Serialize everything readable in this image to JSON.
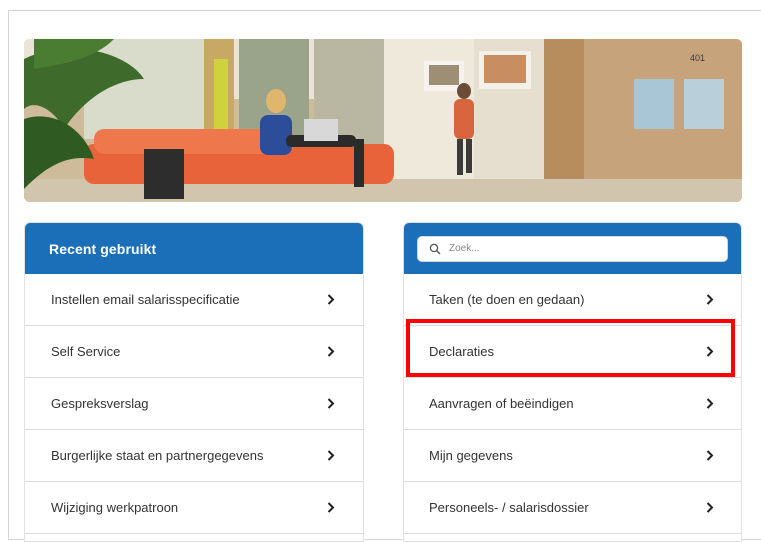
{
  "recent": {
    "title": "Recent gebruikt",
    "items": [
      {
        "label": "Instellen email salarisspecificatie"
      },
      {
        "label": "Self Service"
      },
      {
        "label": "Gespreksverslag"
      },
      {
        "label": "Burgerlijke staat en partnergegevens"
      },
      {
        "label": "Wijziging werkpatroon"
      }
    ]
  },
  "menu": {
    "search": {
      "placeholder": "Zoek..."
    },
    "items": [
      {
        "label": "Taken (te doen en gedaan)"
      },
      {
        "label": "Declaraties"
      },
      {
        "label": "Aanvragen of beëindigen"
      },
      {
        "label": "Mijn gegevens"
      },
      {
        "label": "Personeels- / salarisdossier"
      }
    ]
  },
  "hero": {
    "room_number": "401"
  },
  "colors": {
    "header_blue": "#1b6fb8",
    "highlight": "#ff0000",
    "sofa": "#e8623a"
  }
}
